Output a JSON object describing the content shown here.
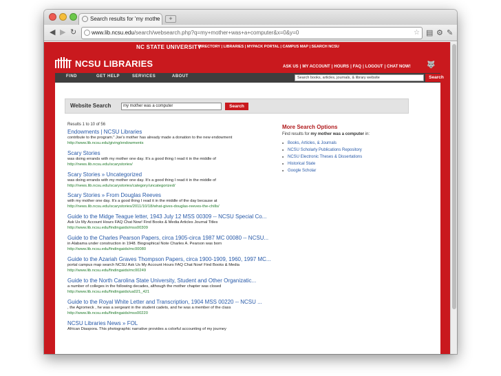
{
  "browser": {
    "tab_title": "Search results for 'my mothe",
    "tab_close": "×",
    "newtab": "+",
    "url_host": "www.lib.ncsu.edu",
    "url_rest": "/search/websearch.php?q=my+mother+was+a+computer&x=0&y=0"
  },
  "header": {
    "university": "NC STATE UNIVERSITY",
    "univ_links": "DIRECTORY  |  LIBRARIES  |  MYPACK PORTAL  |  CAMPUS MAP  |  SEARCH NCSU",
    "logo": "NCSU LIBRARIES",
    "util_links": [
      "ASK US",
      "MY ACCOUNT",
      "HOURS",
      "FAQ",
      "LOGOUT",
      "CHAT NOW!"
    ]
  },
  "nav": {
    "items": [
      "FIND",
      "GET HELP",
      "SERVICES",
      "ABOUT"
    ],
    "search_placeholder": "Search books, articles, journals, & library website",
    "search_button": "Search"
  },
  "website_search": {
    "label": "Website Search",
    "query": "my mother was a computer",
    "button": "Search"
  },
  "results_count": "Results 1 to 10 of 56",
  "results": [
    {
      "title": "Endowments | NCSU Libraries",
      "desc": [
        "contribute to the program.\" Joe's mother has already made a donation to the new endowment"
      ],
      "url": "http://www.lib.ncsu.edu/giving/endowments"
    },
    {
      "title": "Scary Stories",
      "desc": [
        "was doing errands with my mother one day. It's a good thing I read it in the middle of"
      ],
      "url": "http://news.lib.ncsu.edu/scarystories/"
    },
    {
      "title": "Scary Stories » Uncategorized",
      "desc": [
        "was doing errands with my mother one day. It's a good thing I read it in the middle of"
      ],
      "url": "http://news.lib.ncsu.edu/scarystories/category/uncategorized/"
    },
    {
      "title": "Scary Stories » From Douglas Reeves",
      "desc": [
        "with my mother one day. It's a good thing I read it in the middle of the day because at"
      ],
      "url": "http://news.lib.ncsu.edu/scarystories/2011/10/18/what-gives-douglas-reeves-the-chills/"
    },
    {
      "title": "Guide to the Midge Teague letter, 1943 July 12 MSS 00309 -- NCSU Special Co...",
      "desc": [
        "Ask Us My Account Hours FAQ Chat Now! Find Books & Media Articles Journal Titles"
      ],
      "url": "http://www.lib.ncsu.edu/findingaids/mss00309"
    },
    {
      "title": "Guide to the Charles Pearson Papers, circa 1905-circa 1987 MC 00080 -- NCSU...",
      "desc": [
        "in Alabama under construction in 1948. Biographical Note Charles A. Pearson was born"
      ],
      "url": "http://www.lib.ncsu.edu/findingaids/mc00080"
    },
    {
      "title": "Guide to the Azariah Graves Thompson Papers, circa 1900-1909, 1960, 1997 MC...",
      "desc": [
        "portal campus map search NCSU Ask Us My Account Hours FAQ Chat Now! Find Books & Media"
      ],
      "url": "http://www.lib.ncsu.edu/findingaids/mc00249"
    },
    {
      "title": "Guide to the North Carolina State University, Student and Other Organizatic...",
      "desc": [
        "a number of colleges in the following decades, although the mother chapter was closed"
      ],
      "url": "http://www.lib.ncsu.edu/findingaids/ua021_421"
    },
    {
      "title": "Guide to the Royal White Letter and Transcription, 1904 MSS 00220 -- NCSU ...",
      "desc": [
        ", the Agromeck , he was a sergeant in the student cadets, and he was a member of the class"
      ],
      "url": "http://www.lib.ncsu.edu/findingaids/mss00220"
    },
    {
      "title": "NCSU Libraries News » FOL",
      "desc": [
        "African Diaspora. This photographic narrative provides a colorful accounting of my journey"
      ],
      "url": ""
    }
  ],
  "more_options": {
    "title": "More Search Options",
    "desc_prefix": "Find results for ",
    "desc_query": "my mother was a computer",
    "desc_suffix": " in:",
    "links": [
      "Books, Articles, & Journals",
      "NCSU Scholarly Publications Repository",
      "NCSU Electronic Theses & Dissertations",
      "Historical State",
      "Google Scholar"
    ]
  },
  "colors": {
    "brand_red": "#c9191e",
    "link_blue": "#2759a8",
    "url_green": "#1f7a2a"
  }
}
